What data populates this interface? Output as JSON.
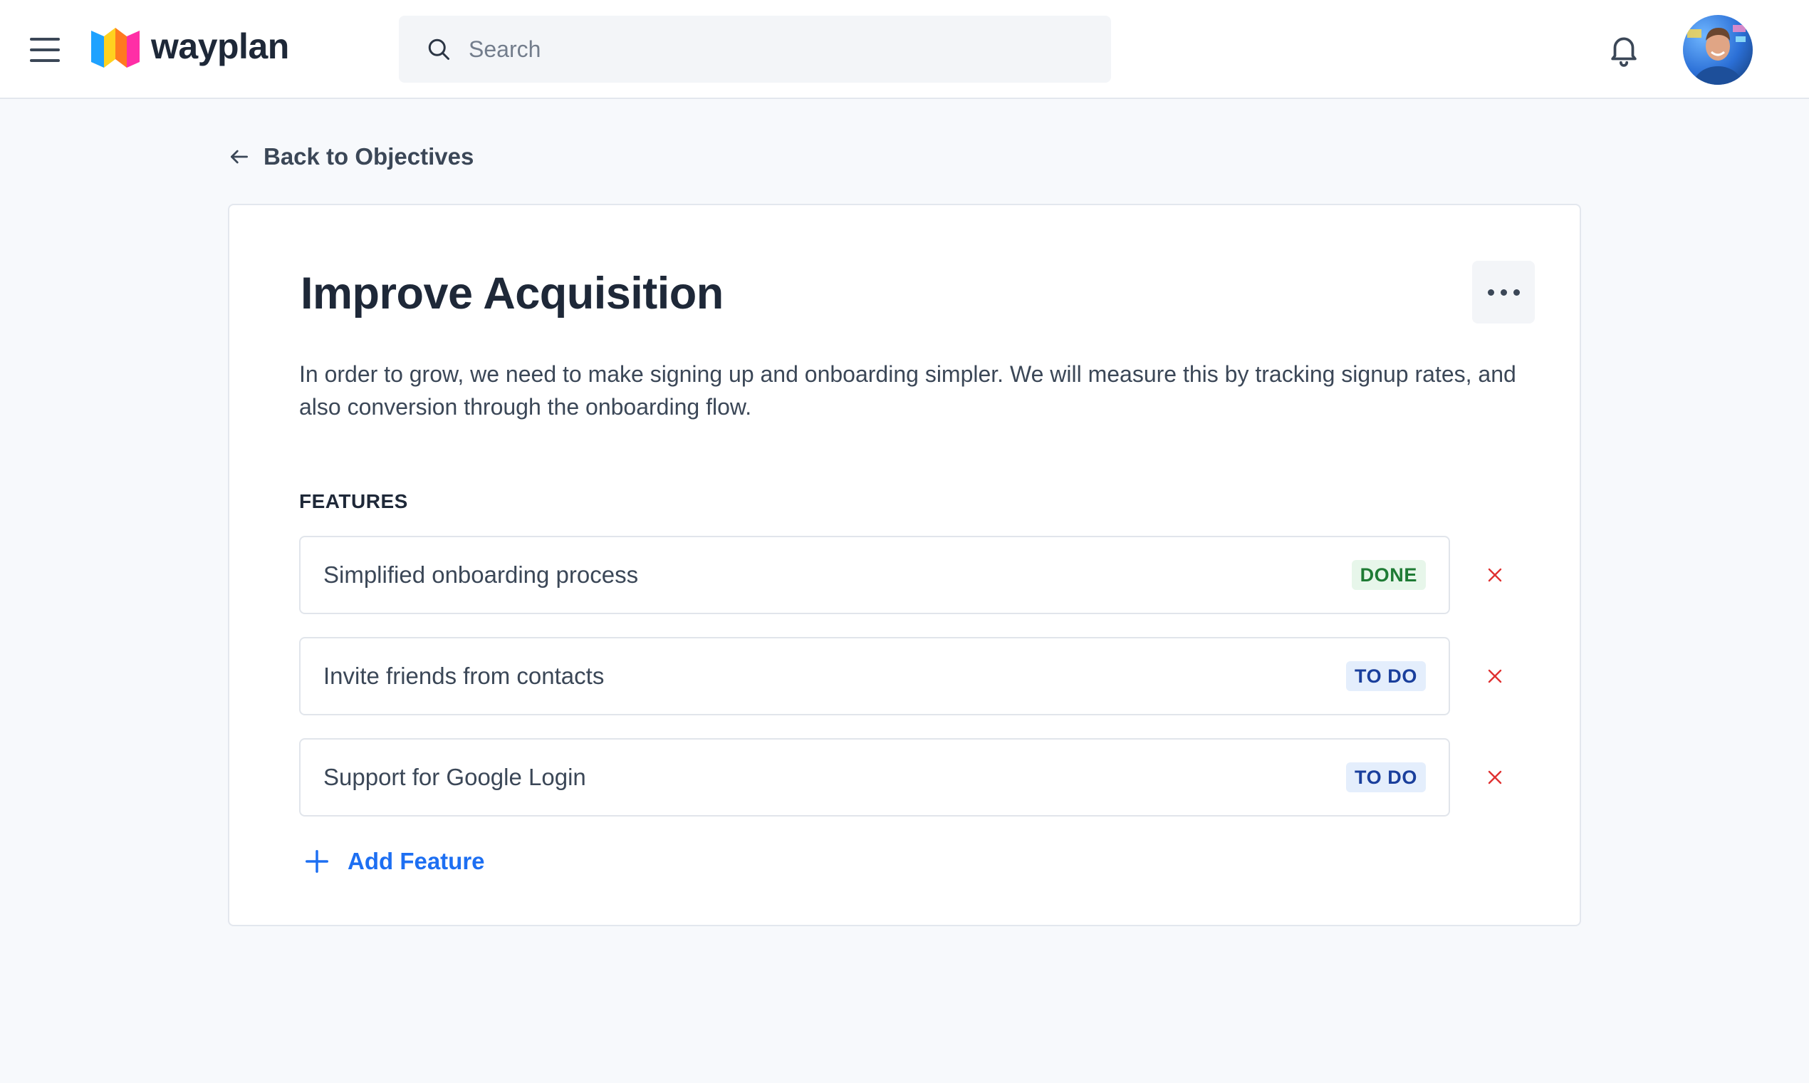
{
  "header": {
    "brand": "wayplan",
    "search_placeholder": "Search",
    "search_value": ""
  },
  "back_link": {
    "label": "Back to Objectives"
  },
  "objective": {
    "title": "Improve Acquisition",
    "description": "In order to grow, we need to make signing up and onboarding simpler. We will measure this by tracking signup rates, and also conversion through the onboarding flow."
  },
  "features": {
    "heading": "FEATURES",
    "items": [
      {
        "name": "Simplified onboarding process",
        "status": "DONE"
      },
      {
        "name": "Invite friends from contacts",
        "status": "TO DO"
      },
      {
        "name": "Support for Google Login",
        "status": "TO DO"
      }
    ],
    "add_label": "Add Feature"
  },
  "colors": {
    "accent": "#1d6ff2",
    "done_bg": "#e7f6ea",
    "done_text": "#1e7b34",
    "todo_bg": "#e4eefc",
    "todo_text": "#1a3f9c",
    "remove": "#e03131"
  },
  "icons": {
    "menu": "hamburger-icon",
    "logo": "wayplan-logo-icon",
    "search": "search-icon",
    "notifications": "bell-icon",
    "back": "arrow-left-icon",
    "more": "more-horizontal-icon",
    "remove": "close-icon",
    "add": "plus-icon"
  }
}
